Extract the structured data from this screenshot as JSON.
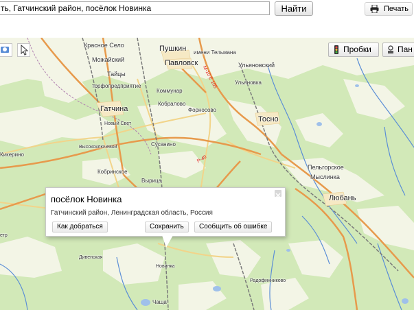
{
  "search": {
    "value": "ть, Гатчинский район, посёлок Новинка",
    "find_label": "Найти"
  },
  "print": {
    "label": "Печать"
  },
  "map_controls": {
    "traffic_label": "Пробки",
    "panorama_label": "Пан"
  },
  "balloon": {
    "title": "посёлок Новинка",
    "address": "Гатчинский район, Ленинградская область, Россия",
    "route_label": "Как добраться",
    "save_label": "Сохранить",
    "report_label": "Сообщить об ошибке"
  },
  "places": {
    "pushkin": "Пушкин",
    "pavlovsk": "Павловск",
    "gatchina": "Гатчина",
    "tosno": "Тосно",
    "lyuban": "Любань",
    "krasnoe_selo": "Красное Село",
    "mozhaysky": "Можайский",
    "taitsy": "Тайцы",
    "torfopredpriyatie": "торфопредприятие",
    "imeni_telmana": "имени Тельмана",
    "ulyanovsky": "Ульяновский",
    "ulyanovka": "Ульяновка",
    "kommunar": "Коммунар",
    "kobralovo": "Кобралово",
    "fornosovo": "Форносово",
    "novy_svet": "Новый Свет",
    "vysokoklyuchevoy": "Высокоключевой",
    "susanino": "Сусанино",
    "kikerino": "Кикерино",
    "kobrinskoe": "Кобринское",
    "vyritsa": "Вырица",
    "pelgorskoe": "Пельгорское",
    "myslinka": "Мыслинка",
    "divenskaya": "Дивенская",
    "novinka": "Новинка",
    "radofinnikovo": "Радофинниково",
    "chascha": "Чаща",
    "etr": "етр"
  },
  "roads": {
    "m10": "М-10 Е 105",
    "r40": "Р-40"
  },
  "colors": {
    "forest": "#d2e9b8",
    "field": "#f2f4e4",
    "major_road": "#e79a4c",
    "railway": "#7a7a7a",
    "water": "#9fc0ea",
    "river": "#5b8ed6"
  }
}
